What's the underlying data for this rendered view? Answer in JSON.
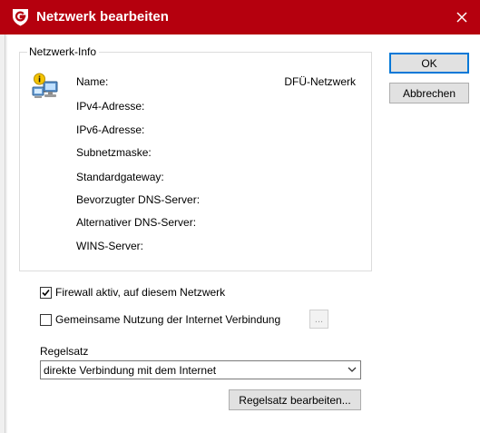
{
  "window": {
    "title": "Netzwerk bearbeiten",
    "title_bar_color": "#b5000e"
  },
  "network_info": {
    "legend": "Netzwerk-Info",
    "icon": "network-connection-icon",
    "rows": [
      {
        "label": "Name:",
        "value": "DFÜ-Netzwerk"
      },
      {
        "label": "IPv4-Adresse:",
        "value": ""
      },
      {
        "label": "IPv6-Adresse:",
        "value": ""
      },
      {
        "label": "Subnetzmaske:",
        "value": ""
      },
      {
        "label": "Standardgateway:",
        "value": ""
      },
      {
        "label": "Bevorzugter DNS-Server:",
        "value": ""
      },
      {
        "label": "Alternativer DNS-Server:",
        "value": ""
      },
      {
        "label": "WINS-Server:",
        "value": ""
      }
    ]
  },
  "buttons": {
    "ok": "OK",
    "cancel": "Abbrechen",
    "more": "...",
    "edit_ruleset": "Regelsatz bearbeiten..."
  },
  "options": {
    "firewall": {
      "label": "Firewall aktiv, auf diesem Netzwerk",
      "checked": true
    },
    "sharing": {
      "label": "Gemeinsame Nutzung der Internet Verbindung",
      "checked": false
    }
  },
  "ruleset": {
    "label": "Regelsatz",
    "selected": "direkte Verbindung mit dem Internet"
  }
}
